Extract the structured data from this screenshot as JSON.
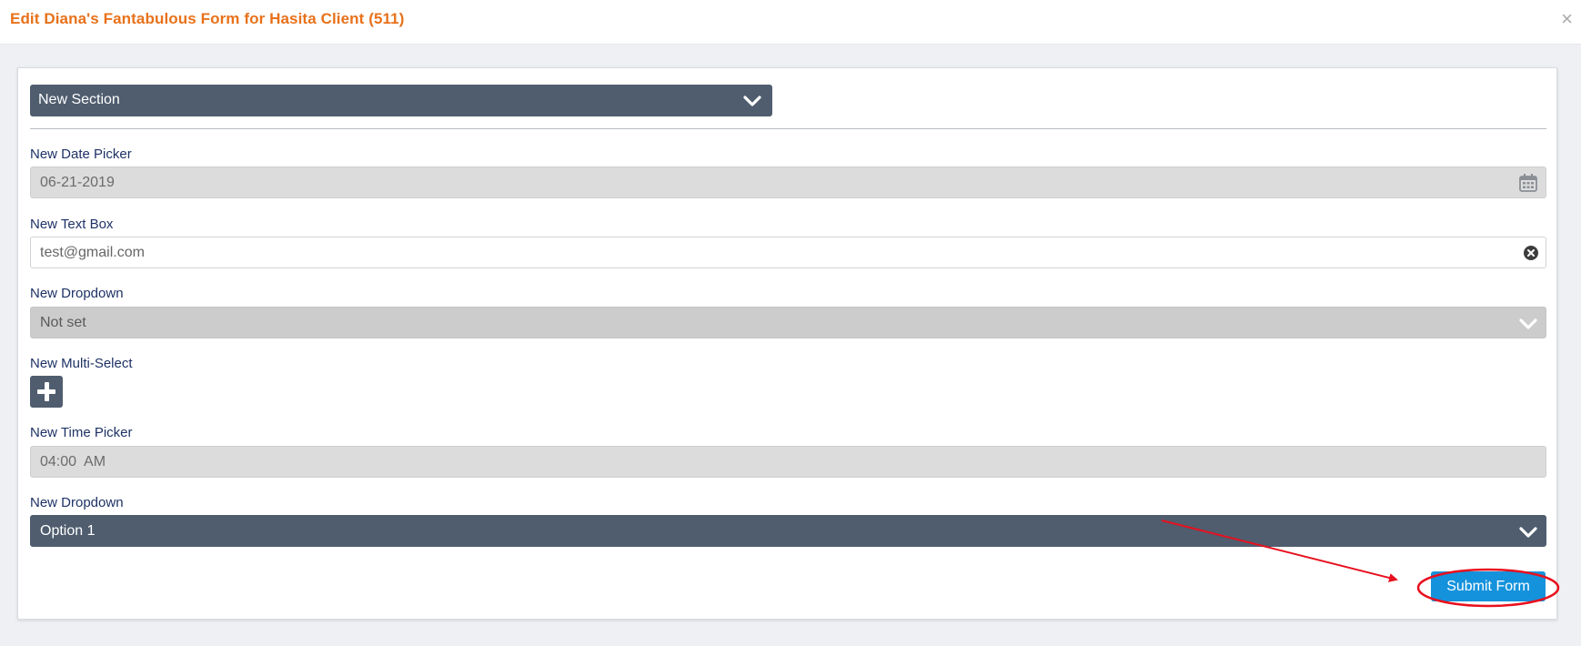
{
  "modal": {
    "title": "Edit Diana's Fantabulous Form for Hasita Client (511)",
    "close_label": "×"
  },
  "section": {
    "label": "New Section"
  },
  "fields": {
    "date_picker": {
      "label": "New Date Picker",
      "value": "06-21-2019"
    },
    "text_box": {
      "label": "New Text Box",
      "value": "test@gmail.com"
    },
    "dropdown_1": {
      "label": "New Dropdown",
      "value": "Not set"
    },
    "multi_select": {
      "label": "New Multi-Select"
    },
    "time_picker": {
      "label": "New Time Picker",
      "value": "04:00  AM"
    },
    "dropdown_2": {
      "label": "New Dropdown",
      "value": "Option 1"
    }
  },
  "actions": {
    "submit_label": "Submit Form"
  },
  "colors": {
    "title": "#e8711a",
    "label": "#1e3266",
    "dark_bar": "#4f5d6e",
    "submit": "#1592dc",
    "annotation": "#e8101e"
  },
  "icons": {
    "section_toggle": "chevron-down-icon",
    "date": "calendar-icon",
    "clear": "clear-circle-icon",
    "add": "plus-icon"
  }
}
